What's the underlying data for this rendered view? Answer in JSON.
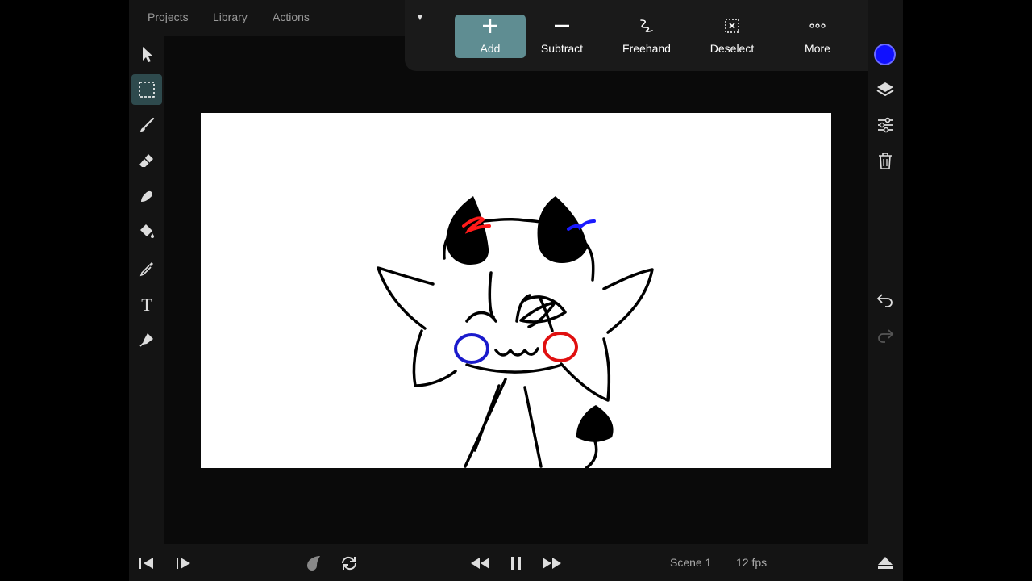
{
  "menu": {
    "projects": "Projects",
    "library": "Library",
    "actions": "Actions"
  },
  "toolbar": {
    "add": "Add",
    "subtract": "Subtract",
    "freehand": "Freehand",
    "deselect": "Deselect",
    "more": "More"
  },
  "left_tools": [
    "select-arrow",
    "selection",
    "brush",
    "eraser",
    "smudge",
    "fill",
    "eyedropper",
    "text",
    "pen"
  ],
  "right_tools": [
    "layers",
    "adjustments",
    "trash",
    "undo",
    "redo"
  ],
  "current_color": "#1010ff",
  "accent": "#5f8d92",
  "playback": {
    "scene": "Scene 1",
    "fps": "12 fps"
  },
  "icons": [
    "prev-frame-icon",
    "next-frame-icon",
    "onion-skin-icon",
    "loop-icon",
    "rewind-icon",
    "pause-icon",
    "fast-forward-icon",
    "eject-icon"
  ]
}
